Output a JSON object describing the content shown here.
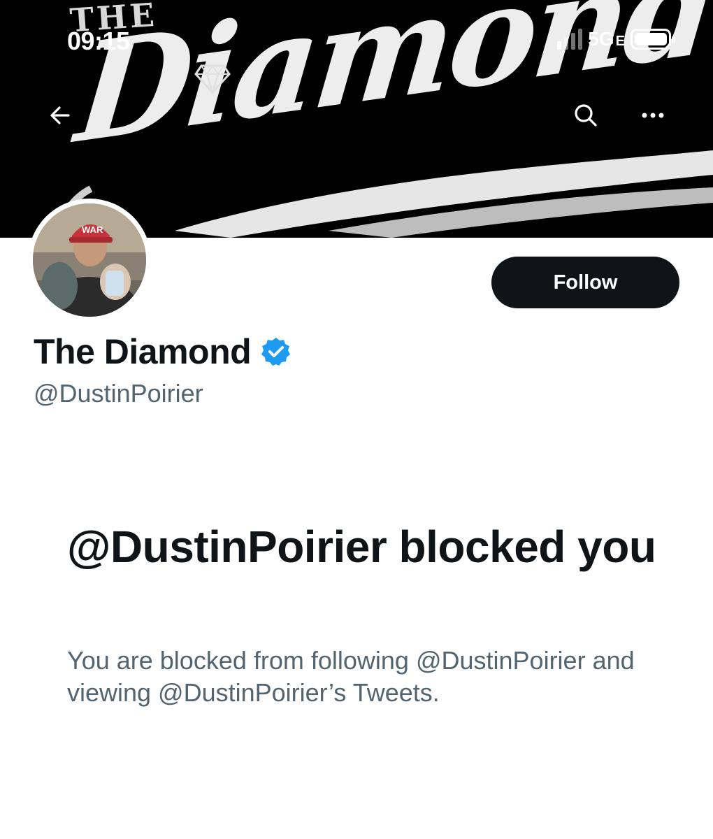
{
  "status_bar": {
    "time": "09:15",
    "network": "5G",
    "network_suffix": "E",
    "battery_level": 1.0
  },
  "banner": {
    "small_text": "THE",
    "main_text": "Diamond",
    "logo_icon": "diamond-icon"
  },
  "nav": {
    "back_icon": "arrow-left-icon",
    "search_icon": "search-icon",
    "more_icon": "more-dots-icon"
  },
  "profile": {
    "avatar_cap_text": "WAR",
    "display_name": "The Diamond",
    "verified": true,
    "verified_color": "#1d9bf0",
    "handle": "@DustinPoirier",
    "follow_label": "Follow"
  },
  "blocked": {
    "title": "@DustinPoirier blocked you",
    "description": "You are blocked from following @DustinPoirier and viewing @DustinPoirier’s Tweets."
  },
  "colors": {
    "primary_text": "#0f1419",
    "secondary_text": "#536471",
    "button_bg": "#0f1419",
    "banner_bg": "#000000"
  }
}
